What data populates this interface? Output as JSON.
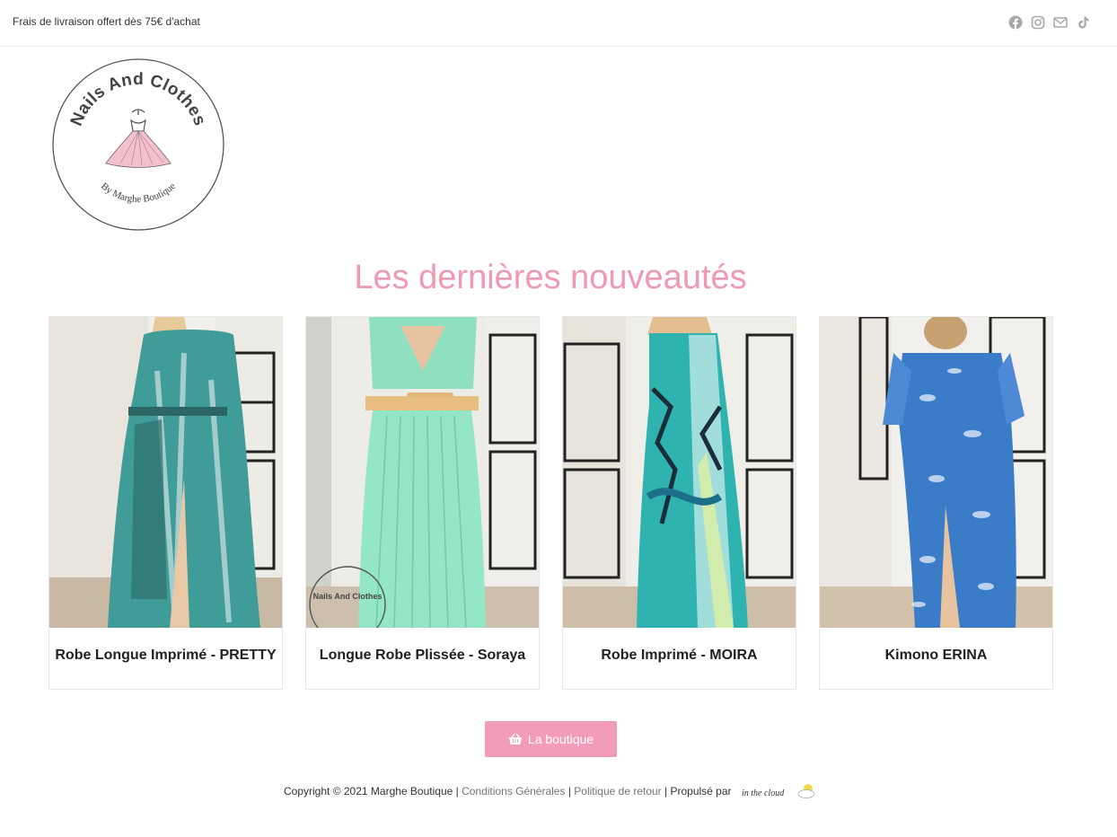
{
  "topbar": {
    "promo_text": "Frais de livraison offert dès 75€ d'achat",
    "social_icons": [
      "facebook-icon",
      "instagram-icon",
      "email-icon",
      "tiktok-icon"
    ]
  },
  "logo": {
    "title": "Nails And Clothes",
    "subtitle": "By Marghe Boutique"
  },
  "section": {
    "title": "Les dernières nouveautés"
  },
  "products": [
    {
      "name": "Robe Longue Imprimé - PRETTY",
      "dress_color": "#3f9c98"
    },
    {
      "name": "Longue Robe Plissée - Soraya",
      "dress_color": "#8fe0c0"
    },
    {
      "name": "Robe Imprimé - MOIRA",
      "dress_color": "#2fb3b0"
    },
    {
      "name": "Kimono ERINA",
      "dress_color": "#3b7cc9"
    }
  ],
  "product_watermark": "Nails And Clothes",
  "shop_button": {
    "label": "La boutique",
    "icon": "basket-icon"
  },
  "footer": {
    "copyright": "Copyright © 2021 Marghe Boutique | ",
    "terms_link": "Conditions Générales",
    "sep1": " | ",
    "returns_link": "Politique de retour",
    "powered": " | Propulsé par ",
    "powered_brand": "in the cloud"
  },
  "colors": {
    "accent_pink": "#f29cb7",
    "title_pink": "#f09ab4",
    "icon_grey": "#a9a9a9"
  }
}
